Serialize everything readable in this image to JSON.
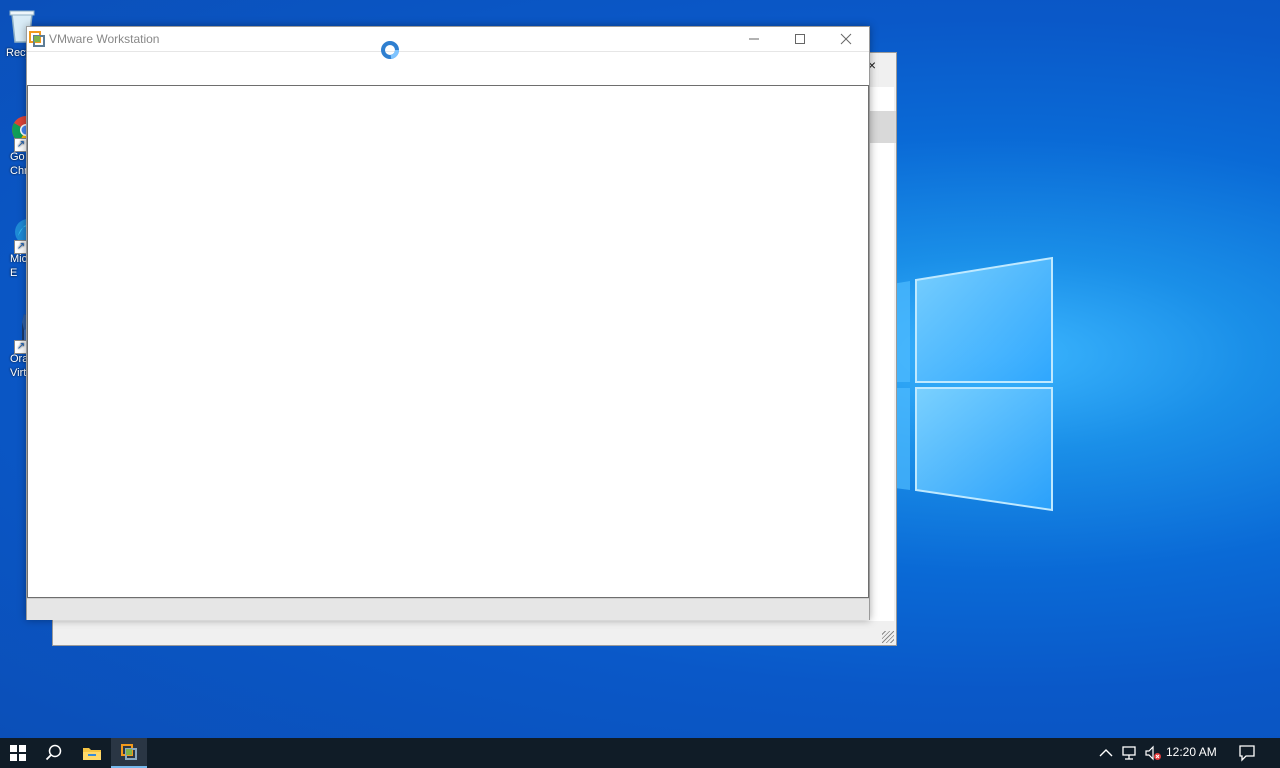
{
  "desktop": {
    "icons": [
      {
        "name": "recycle-bin",
        "label": "Recy"
      },
      {
        "name": "google-chrome",
        "label": "Go\nChr"
      },
      {
        "name": "microsoft-edge",
        "label": "Mic\nE"
      },
      {
        "name": "oracle-virtualbox",
        "label": "Ora\nVirt"
      }
    ]
  },
  "window": {
    "title": "VMware Workstation",
    "minimize_icon": "minimize-icon",
    "maximize_icon": "maximize-icon",
    "close_icon": "close-icon"
  },
  "back_window": {
    "close_glyph": "×"
  },
  "taskbar": {
    "time": "12:20 AM",
    "accent": "#76b9ed"
  }
}
